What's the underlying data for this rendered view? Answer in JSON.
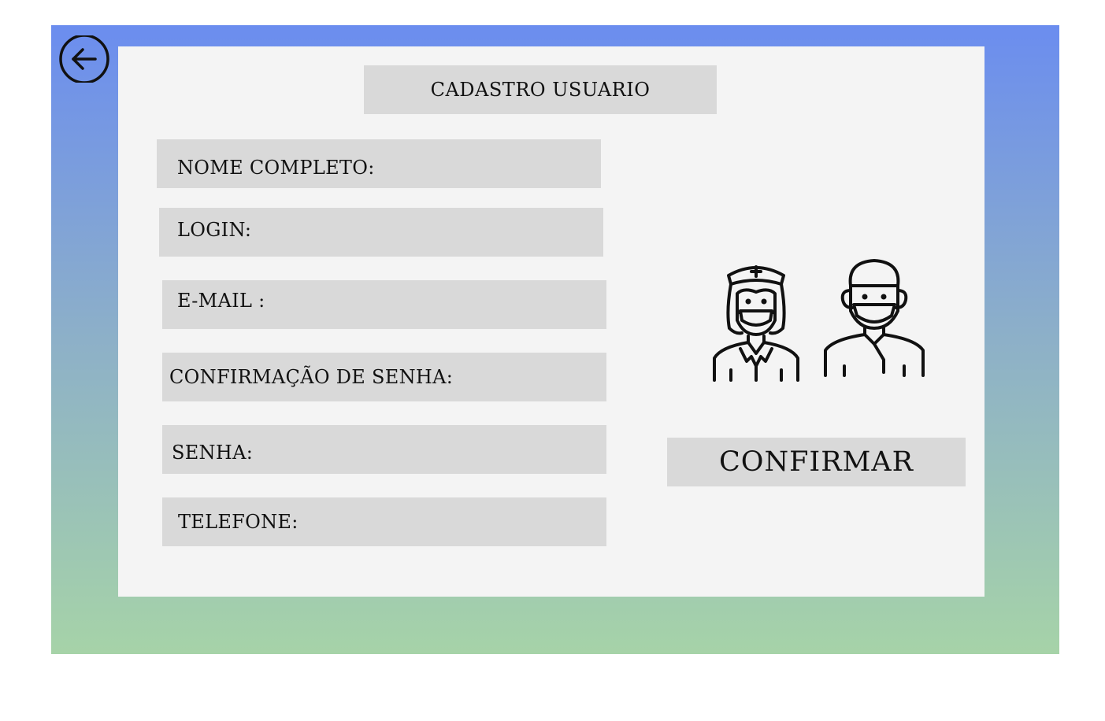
{
  "page": {
    "title": "CADASTRO USUARIO"
  },
  "form": {
    "fields": [
      {
        "id": "nome",
        "label": "NOME COMPLETO:"
      },
      {
        "id": "login",
        "label": "LOGIN:"
      },
      {
        "id": "email",
        "label": "E-MAIL :"
      },
      {
        "id": "confirmacao",
        "label": "CONFIRMAÇÃO DE SENHA:"
      },
      {
        "id": "senha",
        "label": "SENHA:"
      },
      {
        "id": "telefone",
        "label": "TELEFONE:"
      }
    ],
    "confirm_label": "CONFIRMAR"
  },
  "icons": {
    "back": "back-arrow-icon",
    "illustration": "medical-staff-icon"
  },
  "colors": {
    "gradient_top": "#6b8def",
    "gradient_bottom": "#a6d3a8",
    "panel": "#f4f4f4",
    "field": "#d9d9d9"
  }
}
